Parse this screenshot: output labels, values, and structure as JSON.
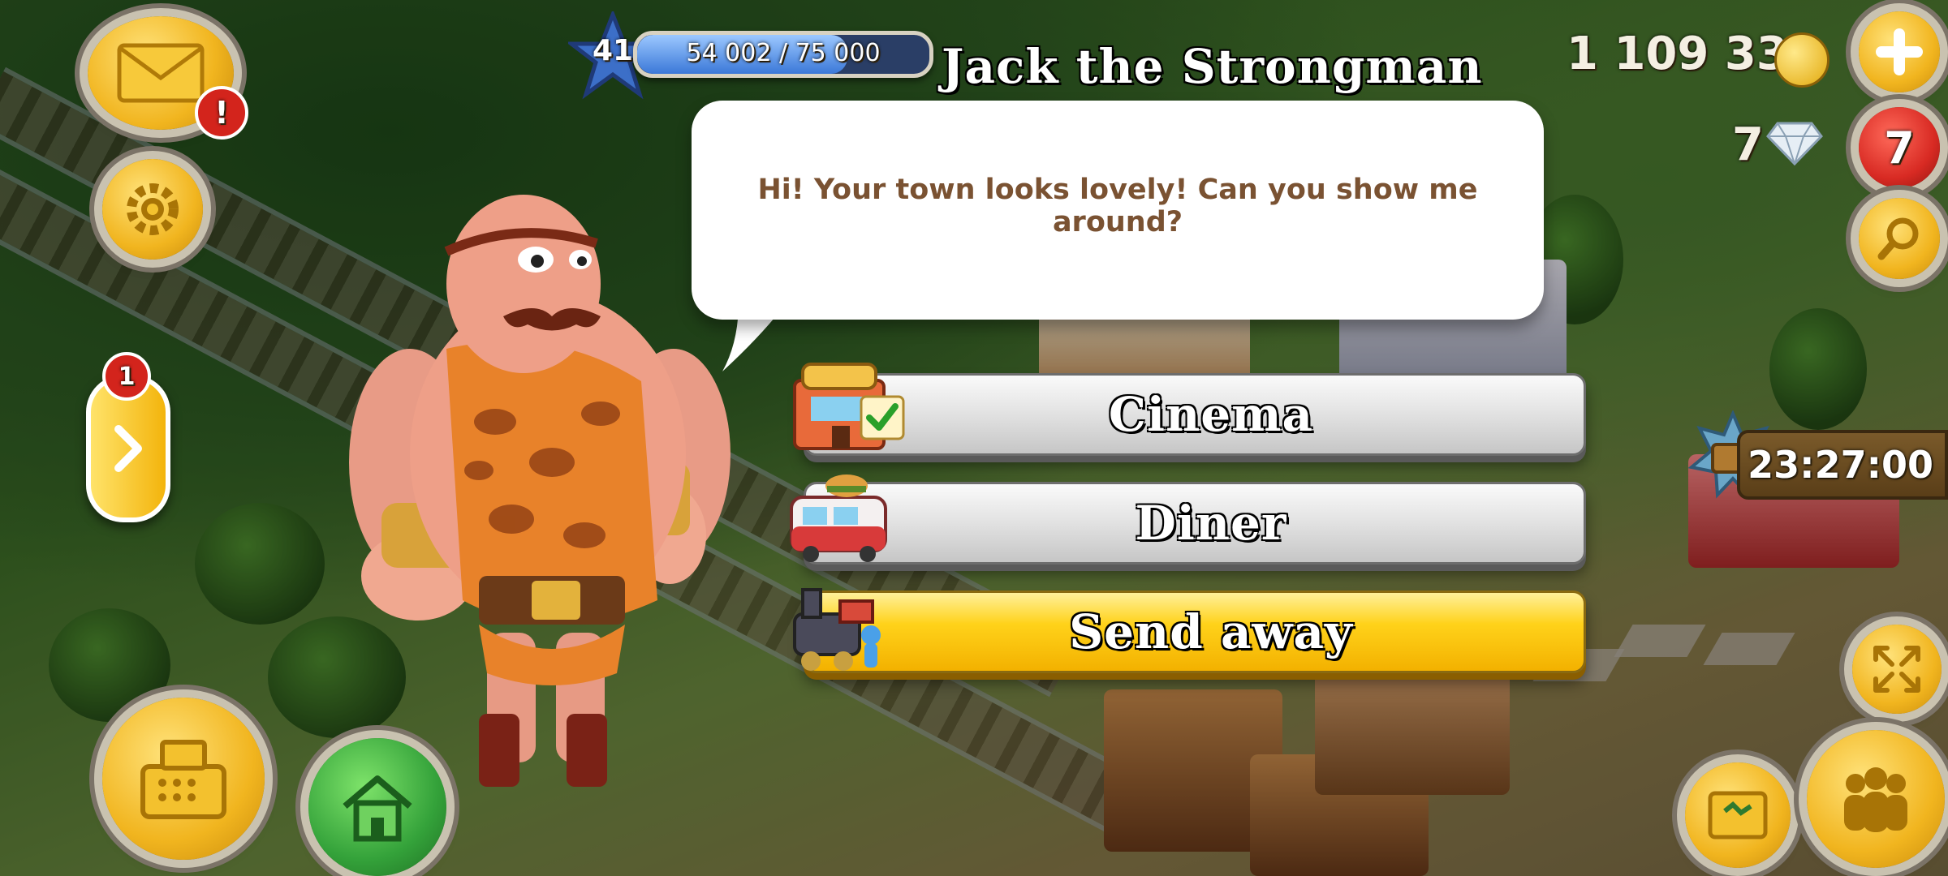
{
  "dialog": {
    "character_name": "Jack the Strongman",
    "message": "Hi! Your town looks lovely! Can you show me around?",
    "options": [
      {
        "label": "Cinema",
        "icon": "cinema-building-icon",
        "completed": true
      },
      {
        "label": "Diner",
        "icon": "diner-truck-icon",
        "completed": false
      },
      {
        "label": "Send away",
        "icon": "train-send-away-icon",
        "completed": false
      }
    ]
  },
  "hud": {
    "level": "41",
    "xp_text": "54 002 / 75 000",
    "xp_fraction": 0.72,
    "coins": "1 109 330",
    "diamonds": "7",
    "diamond_badge": "7",
    "mail_alert": "!",
    "visitor_count": "1",
    "event_timer": "23:27:00"
  },
  "colors": {
    "option_grey": "#e4e4e4",
    "option_yellow": "#ffd21a",
    "message_text": "#7a5232",
    "button_gold": "#f1b51f",
    "button_green": "#34a23a",
    "button_red": "#d82a23"
  }
}
